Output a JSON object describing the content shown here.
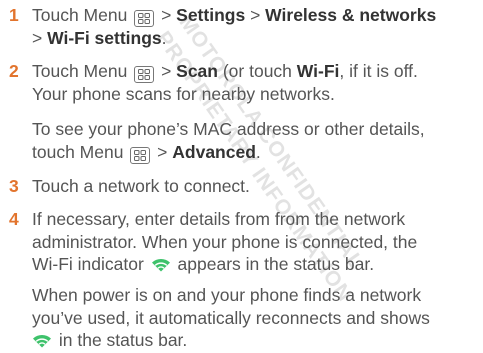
{
  "watermark": {
    "lines": [
      "MOTOROLA CONFIDENTIAL",
      "PROPRIETARY INFORMATION"
    ]
  },
  "colors": {
    "step_number": "#e2742d",
    "body_text": "#555555",
    "bold_text": "#333333",
    "wifi_icon": "#3ec26b"
  },
  "icons": {
    "menu": "menu-key-icon",
    "wifi": "wifi-indicator-icon"
  },
  "steps": [
    {
      "number": "1",
      "p1": "Touch Menu ",
      "p2": " > ",
      "settings": "Settings",
      "p3": " > ",
      "wireless": "Wireless & networks",
      "l2_pre": "> ",
      "wifi_settings": "Wi-Fi settings",
      "l2_post": "."
    },
    {
      "number": "2",
      "p1": "Touch Menu ",
      "p2": " > ",
      "scan": "Scan",
      "p3": " (or touch ",
      "wifi": "Wi-Fi",
      "p4": ", if it is off.",
      "line2": "Your phone scans for nearby networks.",
      "note_l1": "To see your phone’s MAC address or other  details,",
      "note_l2_pre": "touch Menu ",
      "note_l2_mid": " > ",
      "advanced": "Advanced",
      "note_l2_post": "."
    },
    {
      "number": "3",
      "text": "Touch a network to connect."
    },
    {
      "number": "4",
      "line1": "If necessary, enter details from from the network",
      "line2": "administrator. When your phone is connected, the",
      "line3_pre": "Wi-Fi indicator ",
      "line3_post": " appears in the status bar.",
      "note_l1": "When  power is on and your phone finds a network",
      "note_l2": "you’ve used, it automatically reconnects and shows",
      "note_l3_post": " in the status bar."
    }
  ]
}
